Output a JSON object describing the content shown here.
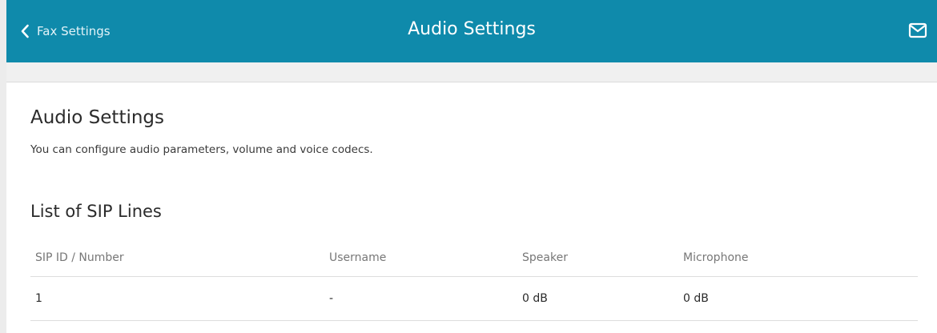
{
  "header": {
    "back_label": "Fax Settings",
    "title": "Audio Settings",
    "back_icon": "chevron-left-icon",
    "mail_icon": "envelope-icon",
    "background_color": "#0f8aab"
  },
  "main": {
    "section_title": "Audio Settings",
    "section_description": "You can configure audio parameters, volume and voice codecs.",
    "list_title": "List of SIP Lines",
    "table": {
      "columns": [
        "SIP ID / Number",
        "Username",
        "Speaker",
        "Microphone"
      ],
      "rows": [
        {
          "sip_id": "1",
          "username": "-",
          "speaker": "0 dB",
          "microphone": "0 dB"
        }
      ]
    }
  }
}
